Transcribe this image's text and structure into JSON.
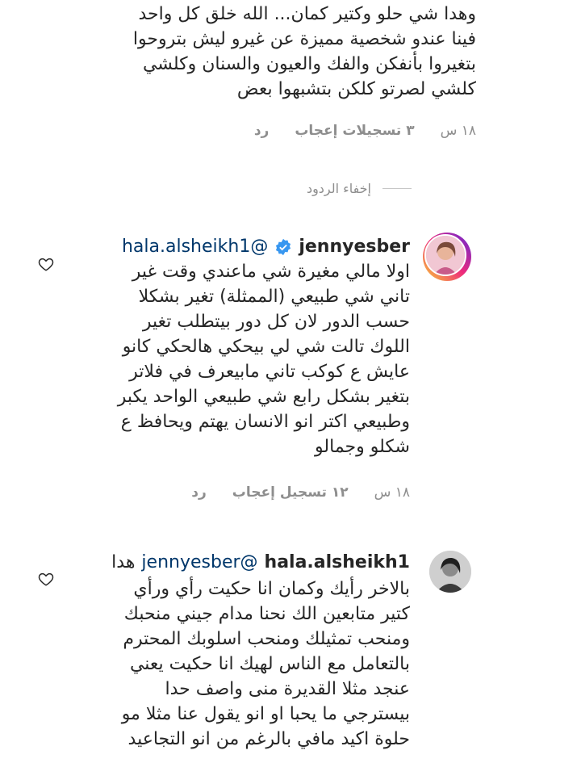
{
  "comment_top": {
    "lines": [
      "وهدا شي حلو وكتير كمان... الله خلق كل واحد",
      "فينا عندو شخصية مميزة عن غيرو ليش بتروحوا",
      "بتغيروا بأنفكن والفك والعيون والسنان وكلشي",
      "كلشي لصرتو كلكن بتشبهوا بعض"
    ],
    "time": "١٨ س",
    "likes": "٣ تسجيلات إعجاب",
    "reply": "رد"
  },
  "hide_replies": "إخفاء الردود",
  "reply_1": {
    "username": "jennyesber",
    "mention": "@hala.alsheikh1",
    "lines": [
      "اولا مالي مغيرة شي ماعندي وقت غير",
      "تاني شي طبيعي (الممثلة) تغير بشكلا",
      "حسب الدور لان كل دور بيتطلب تغير",
      "اللوك تالت شي لي بيحكي هالحكي كانو",
      "عايش ع كوكب تاني مابيعرف في فلاتر",
      "بتغير بشكل رابع شي طبيعي الواحد يكبر",
      "وطبيعي اكتر انو الانسان يهتم ويحافظ ع",
      "شكلو وجمالو"
    ],
    "time": "١٨ س",
    "likes": "١٢ تسجيل إعجاب",
    "reply": "رد"
  },
  "reply_2": {
    "username": "hala.alsheikh1",
    "mention": "@jennyesber",
    "first_word": "هدا",
    "lines": [
      "بالاخر رأيك وكمان انا حكيت رأي ورأي",
      "كتير متابعين الك نحنا مدام جيني منحبك",
      "ومنحب تمثيلك ومنحب اسلوبك المحترم",
      "بالتعامل مع الناس لهيك انا حكيت يعني",
      "عنجد مثلا القديرة منى واصف حدا",
      "بيسترجي ما يحبا او انو يقول عنا مثلا مو",
      "حلوة اكيد مافي بالرغم من انو التجاعيد"
    ]
  }
}
